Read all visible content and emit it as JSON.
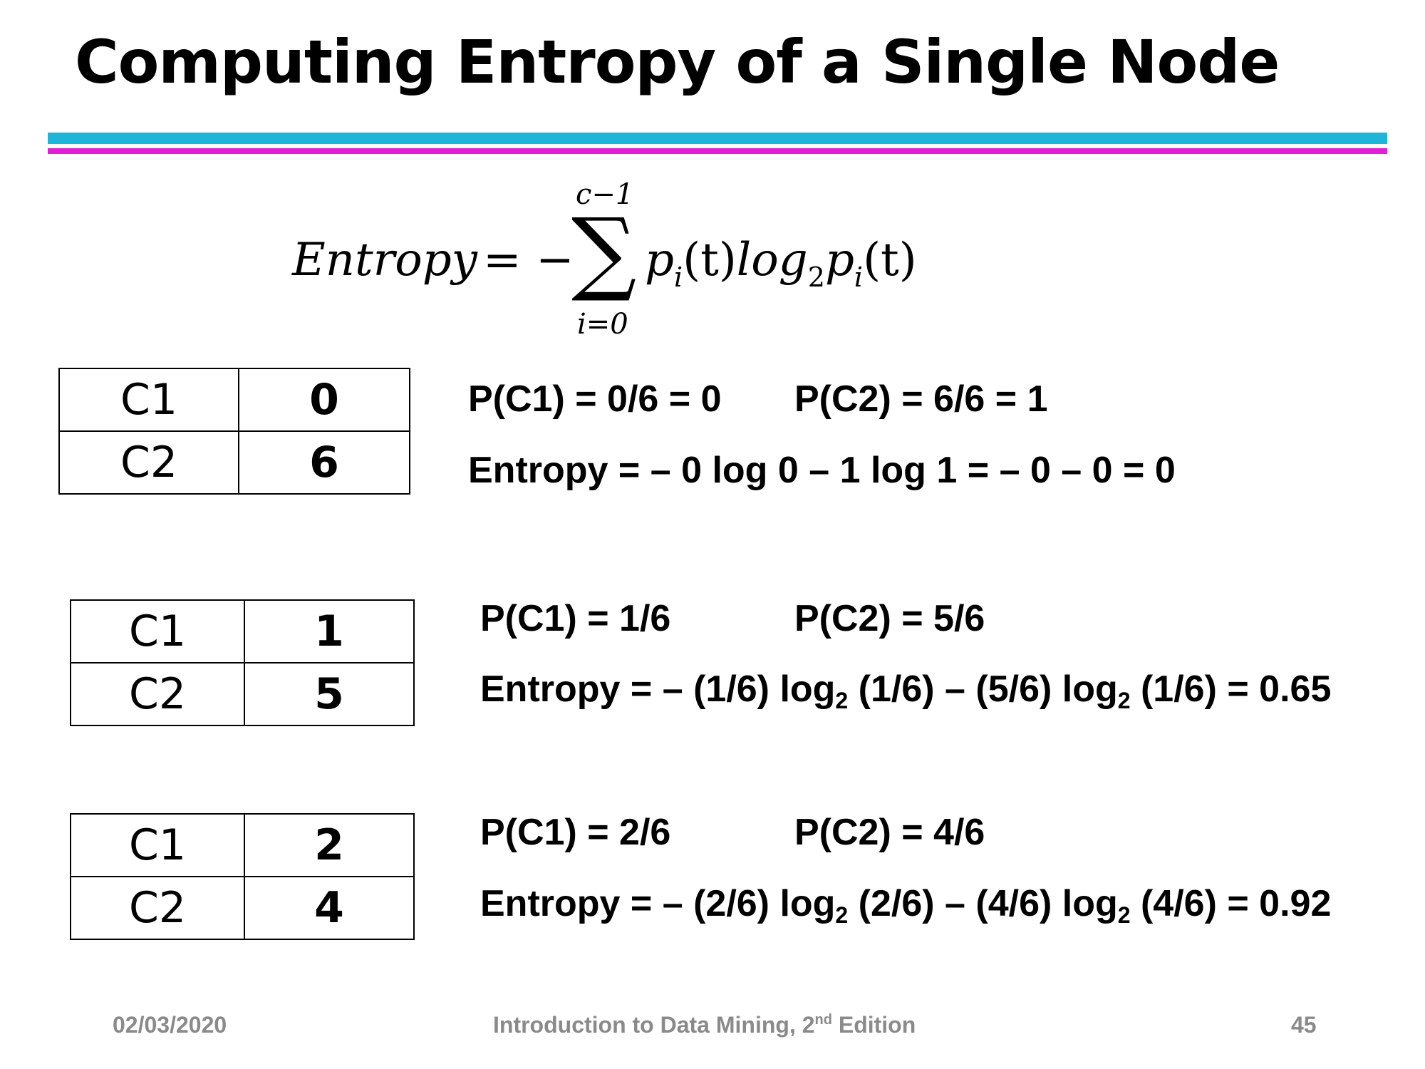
{
  "title": "Computing Entropy of a Single Node",
  "colors": {
    "rule_top": "#1fb5d8",
    "rule_bottom": "#e01fd6",
    "footer_text": "#8a8a8a"
  },
  "formula": {
    "lhs": "Entropy",
    "equals": "=",
    "minus": "−",
    "sum_symbol": "∑",
    "upper_limit": "c−1",
    "lower_limit": "i=0",
    "term_p": "p",
    "term_sub": "i",
    "term_t": "(t)",
    "term_log": "log",
    "term_base": "2"
  },
  "examples": [
    {
      "table": [
        {
          "label": "C1",
          "value": "0"
        },
        {
          "label": "C2",
          "value": "6"
        }
      ],
      "p_c1": "P(C1) = 0/6 = 0",
      "p_c2": "P(C2) = 6/6 = 1",
      "entropy": "Entropy = – 0 log 0 – 1 log 1 = – 0 – 0 = 0"
    },
    {
      "table": [
        {
          "label": "C1",
          "value": "1"
        },
        {
          "label": "C2",
          "value": "5"
        }
      ],
      "p_c1": "P(C1) = 1/6",
      "p_c2": "P(C2) = 5/6",
      "entropy_parts": [
        "Entropy = – (1/6) log",
        "2",
        " (1/6) – (5/6) log",
        "2",
        " (1/6) = 0.65"
      ]
    },
    {
      "table": [
        {
          "label": "C1",
          "value": "2"
        },
        {
          "label": "C2",
          "value": "4"
        }
      ],
      "p_c1": "P(C1) = 2/6",
      "p_c2": "P(C2) = 4/6",
      "entropy_parts": [
        "Entropy = – (2/6) log",
        "2",
        " (2/6) – (4/6) log",
        "2",
        " (4/6) = 0.92"
      ]
    }
  ],
  "footer": {
    "date": "02/03/2020",
    "book_title": "Introduction to Data Mining, 2",
    "book_sup": "nd",
    "book_suffix": " Edition",
    "page": "45"
  }
}
